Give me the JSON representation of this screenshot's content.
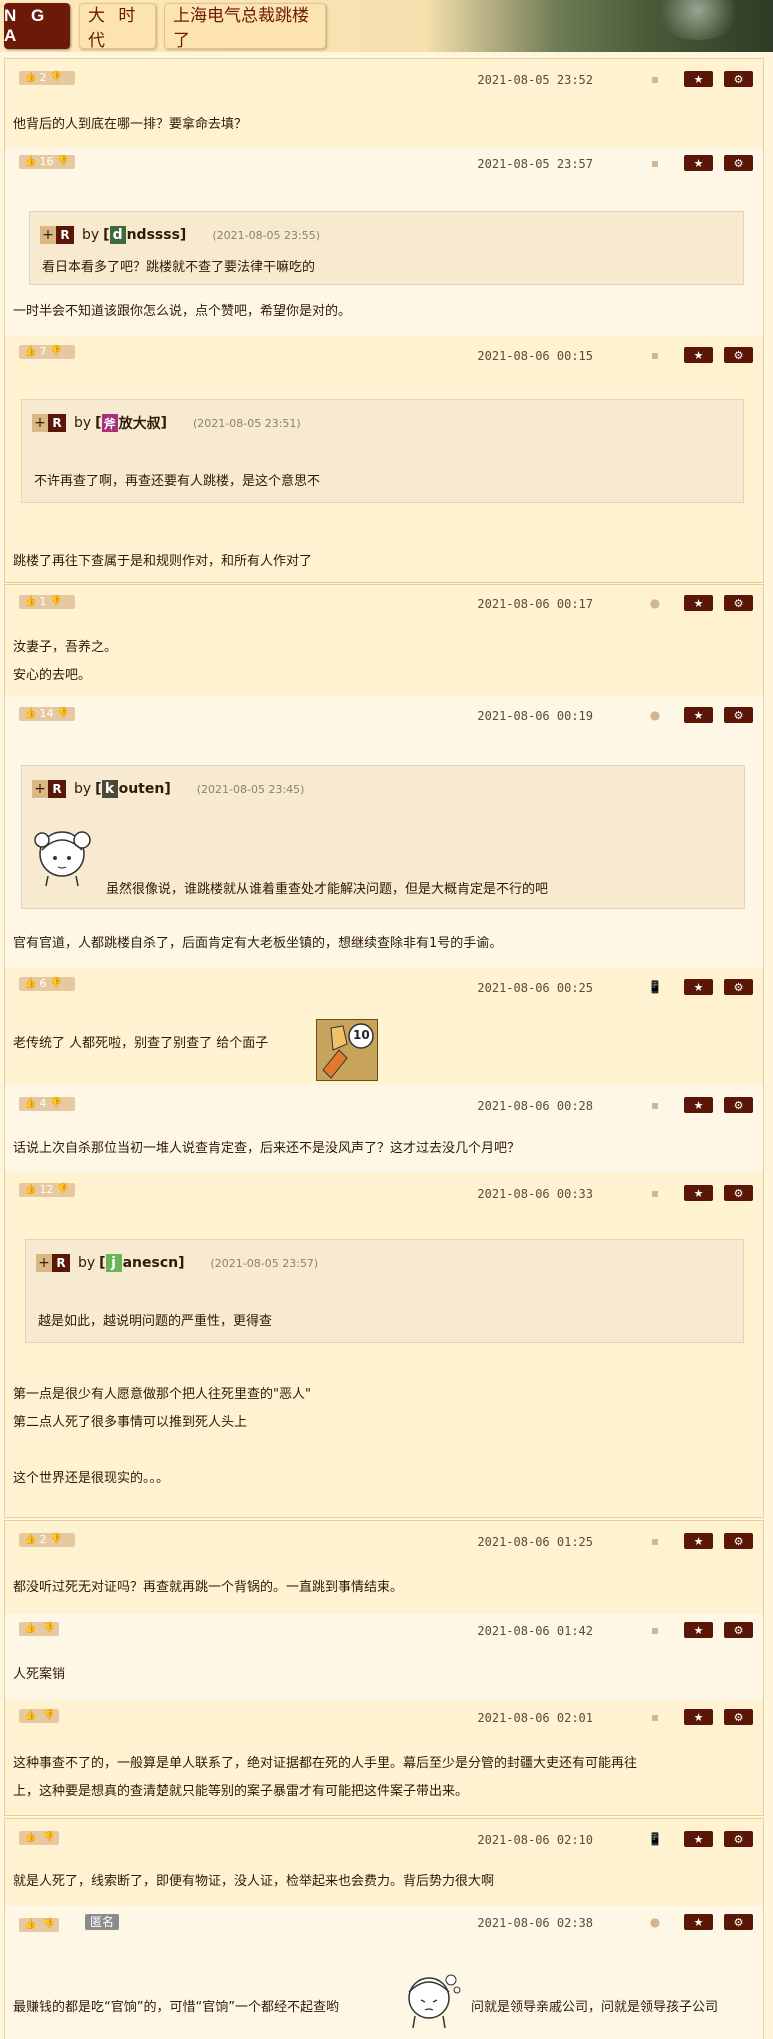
{
  "header": {
    "logo": "N G A",
    "crumbs": [
      "大 时 代",
      "上海电气总裁跳楼了"
    ]
  },
  "posts": [
    {
      "likes": "2",
      "time": "2021-08-05 23:52",
      "text": "他背后的人到底在哪一排？要拿命去填？"
    },
    {
      "likes": "16",
      "time": "2021-08-05 23:57",
      "quote": {
        "initial": "d",
        "user": "ndssss",
        "time": "(2021-08-05 23:55)",
        "text": "看日本看多了吧？跳楼就不查了要法律干嘛吃的"
      },
      "text": "一时半会不知道该跟你怎么说，点个赞吧，希望你是对的。"
    },
    {
      "likes": "7",
      "time": "2021-08-06 00:15",
      "quote": {
        "initial": "斧",
        "user": "放大叔",
        "time": "(2021-08-05 23:51)",
        "text": "不许再查了啊，再查还要有人跳楼，是这个意思不"
      },
      "text": "跳楼了再往下查属于是和规则作对，和所有人作对了"
    },
    {
      "likes": "1",
      "time": "2021-08-06 00:17",
      "lines": [
        "汝妻子，吾养之。",
        "安心的去吧。"
      ]
    },
    {
      "likes": "14",
      "time": "2021-08-06 00:19",
      "quote": {
        "initial": "k",
        "user": "outen",
        "time": "(2021-08-05 23:45)",
        "text": "虽然很像说，谁跳楼就从谁着重查处才能解决问题，但是大概肯定是不行的吧"
      },
      "text": "官有官道，人都跳楼自杀了，后面肯定有大老板坐镇的，想继续查除非有1号的手谕。"
    },
    {
      "likes": "6",
      "time": "2021-08-06 00:25",
      "text": "老传统了 人都死啦，别查了别查了 给个面子",
      "sticker": "10"
    },
    {
      "likes": "4",
      "time": "2021-08-06 00:28",
      "text": "话说上次自杀那位当初一堆人说查肯定查，后来还不是没风声了？这才过去没几个月吧？"
    },
    {
      "likes": "12",
      "time": "2021-08-06 00:33",
      "quote": {
        "initial": "j",
        "user": "anescn",
        "time": "(2021-08-05 23:57)",
        "text": "越是如此，越说明问题的严重性，更得查"
      },
      "lines": [
        "第一点是很少有人愿意做那个把人往死里查的\"恶人\"",
        "第二点人死了很多事情可以推到死人头上",
        "",
        "这个世界还是很现实的。。。"
      ]
    },
    {
      "likes": "2",
      "time": "2021-08-06 01:25",
      "text": "都没听过死无对证吗？再查就再跳一个背锅的。一直跳到事情结束。"
    },
    {
      "likes": "",
      "time": "2021-08-06 01:42",
      "text": "人死案销"
    },
    {
      "likes": "",
      "time": "2021-08-06 02:01",
      "lines": [
        "这种事查不了的，一般算是单人联系了，绝对证据都在死的人手里。幕后至少是分管的封疆大吏还有可能再往",
        "上，这种要是想真的查清楚就只能等别的案子暴雷才有可能把这件案子带出来。"
      ]
    },
    {
      "likes": "",
      "time": "2021-08-06 02:10",
      "text": "就是人死了，线索断了，即便有物证，没人证，检举起来也会费力。背后势力很大啊"
    },
    {
      "likes": "",
      "time": "2021-08-06 02:38",
      "anon": "匿名",
      "text_a": "最赚钱的都是吃“官饷”的，可惜“官饷”一个都经不起查哟",
      "text_b": "问就是领导亲戚公司，问就是领导孩子公司"
    }
  ],
  "ui": {
    "quote_plus": "+",
    "quote_r": "R",
    "quote_by": "by",
    "bracket_open": "[",
    "bracket_close": "]",
    "star_icon": "★",
    "gear_icon": "⚙",
    "thumb_icon": "👍",
    "thumb_down_icon": "👎",
    "phone_icon": "📱"
  },
  "colors": {
    "accent": "#5a1606",
    "background": "#fff5dc",
    "init_d": "#3f6b3a",
    "init_fang": "#a8327a",
    "init_k": "#4a4a3a",
    "init_j": "#6ab55a"
  }
}
